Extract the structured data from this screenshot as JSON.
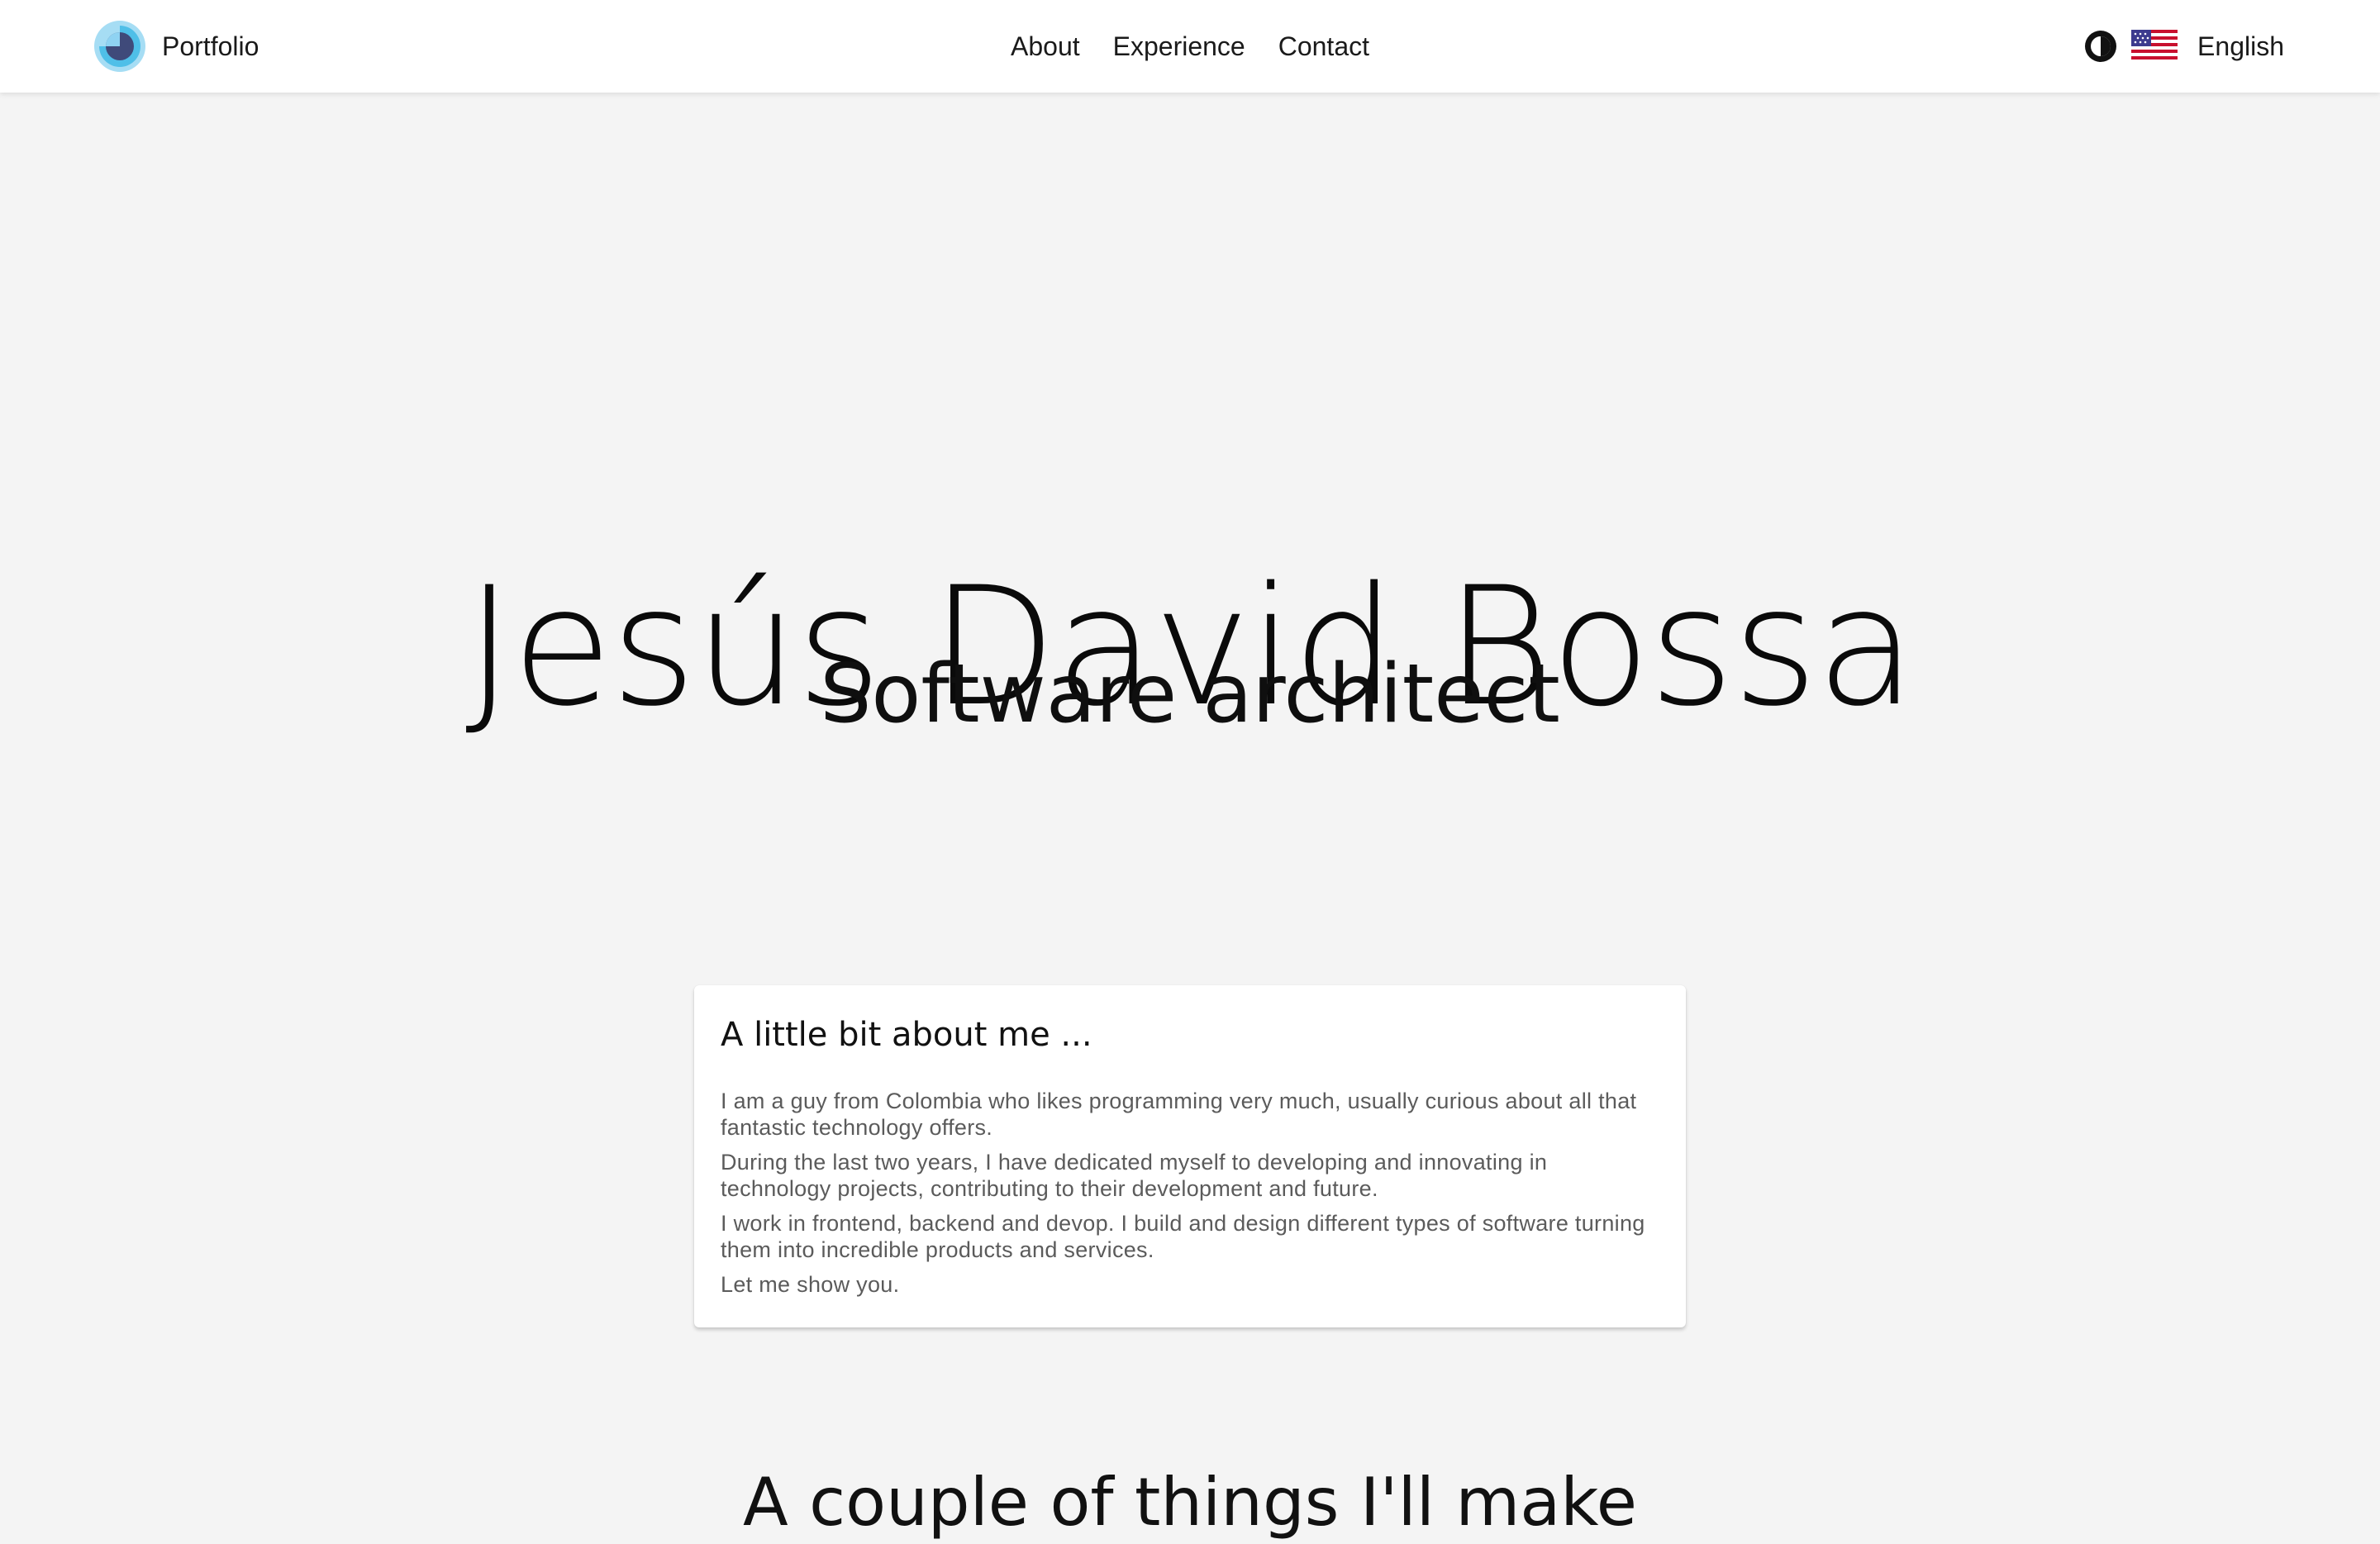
{
  "header": {
    "brand": "Portfolio",
    "nav": [
      "About",
      "Experience",
      "Contact"
    ],
    "language": "English",
    "icons": {
      "logo": "portfolio-logo-icon",
      "theme": "theme-toggle-icon",
      "flag": "us-flag-icon"
    }
  },
  "hero": {
    "name": "Jesús David Bossa",
    "title": "Software architect"
  },
  "about": {
    "heading": "A little bit about me ...",
    "paragraphs": [
      "I am a guy from Colombia who likes programming very much, usually curious about all that fantastic technology offers.",
      "During the last two years, I have dedicated myself to developing and innovating in technology projects, contributing to their development and future.",
      "I work in frontend, backend and devop. I build and design different types of software turning them into incredible products and services.",
      "Let me show you."
    ]
  },
  "next_section": {
    "heading": "A couple of things I'll make"
  },
  "colors": {
    "background": "#f4f4f4",
    "header": "#ffffff",
    "logo_light": "#8fd3f2",
    "logo_dark": "#3f4a7a"
  }
}
